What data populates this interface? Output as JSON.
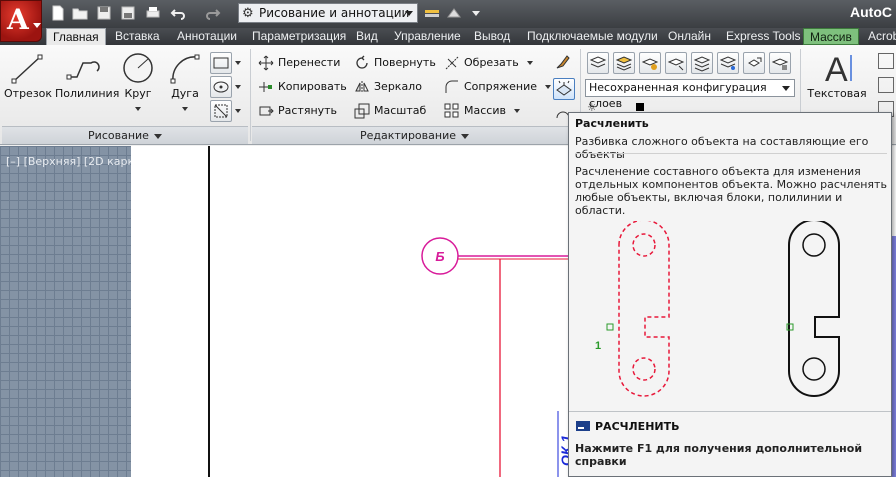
{
  "title_bar": {
    "workspace": "Рисование и аннотации",
    "app_title": "AutoC"
  },
  "tabs": [
    {
      "label": "Главная",
      "active": true
    },
    {
      "label": "Вставка"
    },
    {
      "label": "Аннотации"
    },
    {
      "label": "Параметризация"
    },
    {
      "label": "Вид"
    },
    {
      "label": "Управление"
    },
    {
      "label": "Вывод"
    },
    {
      "label": "Подключаемые модули"
    },
    {
      "label": "Онлайн"
    },
    {
      "label": "Express Tools"
    },
    {
      "label": "Массив",
      "contextual": true
    },
    {
      "label": "Acrob"
    }
  ],
  "draw_panel": {
    "title": "Рисование",
    "line": "Отрезок",
    "polyline": "Полилиния",
    "circle": "Круг",
    "arc": "Дуга"
  },
  "modify_panel": {
    "title": "Редактирование",
    "move": "Перенести",
    "rotate": "Повернуть",
    "trim": "Обрезать",
    "copy": "Копировать",
    "mirror": "Зеркало",
    "fillet": "Сопряжение",
    "stretch": "Растянуть",
    "scale": "Масштаб",
    "array": "Массив"
  },
  "layers_panel": {
    "layer_state": "Несохраненная конфигурация слоев"
  },
  "annotation_panel": {
    "text_label": "Текстовая"
  },
  "viewport": {
    "label": "[–] [Верхняя] [2D карк",
    "bubble_label": "Б",
    "vertical_note": "ОК 1"
  },
  "tooltip": {
    "title": "Расчленить",
    "description": "Разбивка сложного объекта на составляющие его объекты",
    "details": "Расчленение составного объекта для изменения отдельных компонентов объекта. Можно расчленять любые объекты, включая блоки, полилинии и области.",
    "figure_marker": "1",
    "command": "РАСЧЛЕНИТЬ",
    "help": "Нажмите F1 для получения дополнительной справки"
  },
  "colors": {
    "accent_red": "#e8183a",
    "magenta": "#d81b9a",
    "blue_text": "#1a2ad8",
    "contextual_tab": "#7ec07d"
  }
}
